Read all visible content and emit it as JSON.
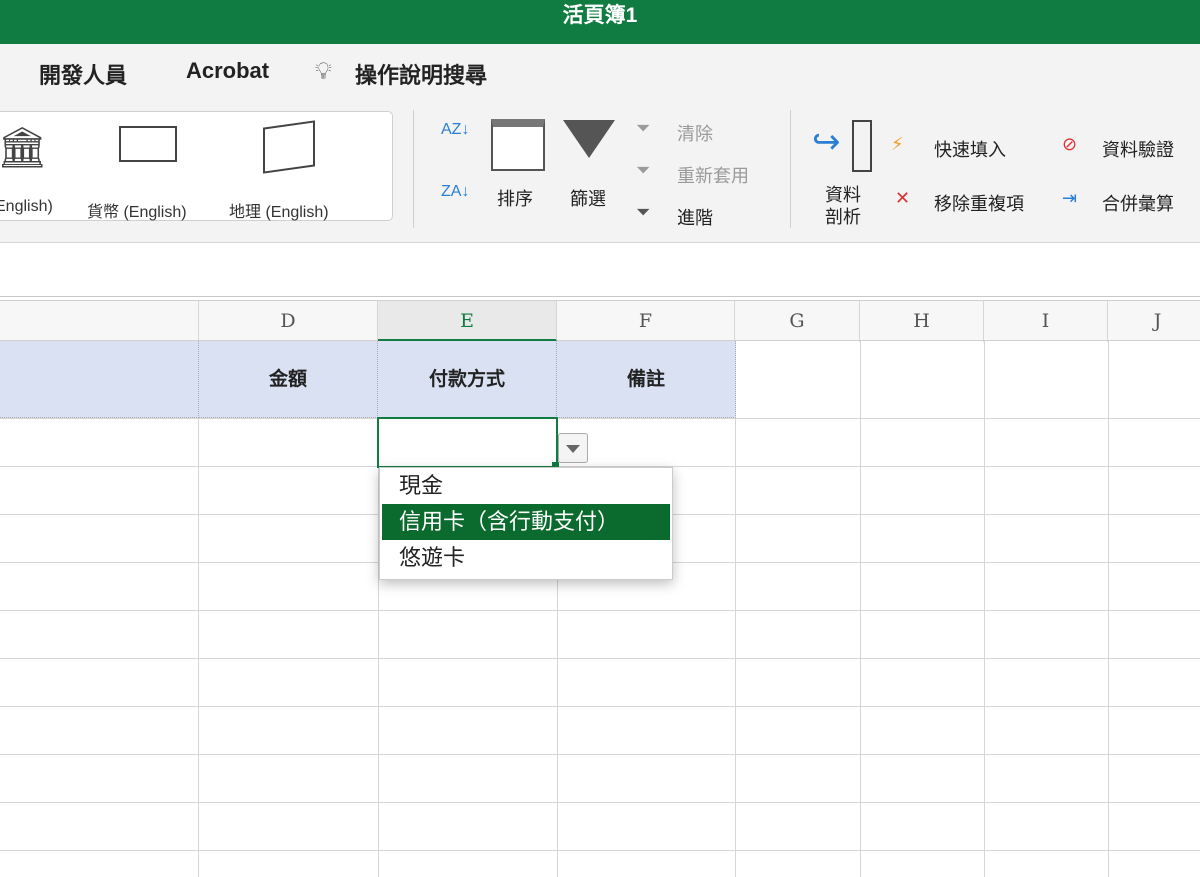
{
  "window": {
    "title": "活頁簿1"
  },
  "menu_tabs": [
    "開發人員",
    "Acrobat",
    "操作說明搜尋"
  ],
  "ribbon": {
    "data_types": [
      "English)",
      "貨幣 (English)",
      "地理 (English)"
    ],
    "sort_filter": {
      "sort_az": "AZ",
      "sort_za": "ZA",
      "sort": "排序",
      "filter": "篩選",
      "clear": "清除",
      "reapply": "重新套用",
      "advanced": "進階"
    },
    "data_tools": {
      "text_to_columns": "資料剖析",
      "flash_fill": "快速填入",
      "remove_duplicates": "移除重複項",
      "data_validation": "資料驗證",
      "consolidate": "合併彙算"
    }
  },
  "grid": {
    "columns": [
      "D",
      "E",
      "F",
      "G",
      "H",
      "I",
      "J"
    ],
    "selected_column": "E",
    "header_row": {
      "D": "金額",
      "E": "付款方式",
      "F": "備註"
    }
  },
  "dropdown": {
    "options": [
      "現金",
      "信用卡（含行動支付）",
      "悠遊卡"
    ],
    "highlighted_index": 1
  }
}
